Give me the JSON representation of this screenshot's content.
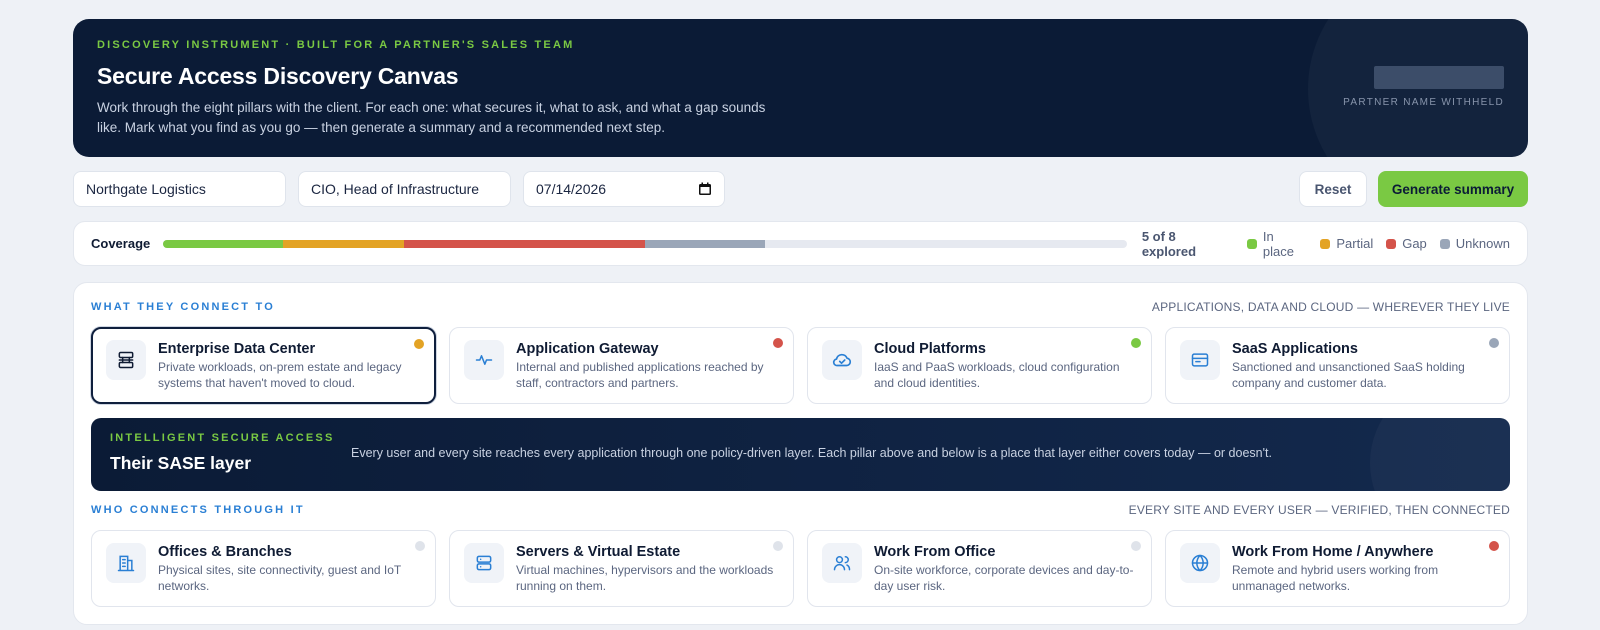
{
  "header": {
    "eyebrow": "DISCOVERY INSTRUMENT · BUILT FOR A PARTNER'S SALES TEAM",
    "title": "Secure Access Discovery Canvas",
    "description": "Work through the eight pillars with the client. For each one: what secures it, what to ask, and what a gap sounds like. Mark what you find as you go — then generate a summary and a recommended next step.",
    "partner_label": "PARTNER NAME WITHHELD"
  },
  "controls": {
    "client_name": "Northgate Logistics",
    "contact_role": "CIO, Head of Infrastructure",
    "date": "07/14/2026",
    "reset_label": "Reset",
    "generate_label": "Generate summary"
  },
  "coverage": {
    "label": "Coverage",
    "explored_text": "5 of 8 explored",
    "segments": [
      {
        "status": "in_place",
        "fraction": 0.125,
        "color": "#7ac943"
      },
      {
        "status": "partial",
        "fraction": 0.125,
        "color": "#e3a325"
      },
      {
        "status": "gap",
        "fraction": 0.25,
        "color": "#d4534a"
      },
      {
        "status": "unknown",
        "fraction": 0.125,
        "color": "#9aa6b8"
      }
    ],
    "legend": [
      {
        "label": "In place",
        "color": "#7ac943"
      },
      {
        "label": "Partial",
        "color": "#e3a325"
      },
      {
        "label": "Gap",
        "color": "#d4534a"
      },
      {
        "label": "Unknown",
        "color": "#9aa6b8"
      }
    ]
  },
  "connect_to": {
    "title": "WHAT THEY CONNECT TO",
    "subtitle": "APPLICATIONS, DATA AND CLOUD — WHEREVER THEY LIVE",
    "cards": [
      {
        "title": "Enterprise Data Center",
        "desc": "Private workloads, on-prem estate and legacy systems that haven't moved to cloud.",
        "icon": "server-rack-icon",
        "status_color": "#e3a325"
      },
      {
        "title": "Application Gateway",
        "desc": "Internal and published applications reached by staff, contractors and partners.",
        "icon": "activity-icon",
        "status_color": "#d4534a"
      },
      {
        "title": "Cloud Platforms",
        "desc": "IaaS and PaaS workloads, cloud configuration and cloud identities.",
        "icon": "cloud-check-icon",
        "status_color": "#7ac943"
      },
      {
        "title": "SaaS Applications",
        "desc": "Sanctioned and unsanctioned SaaS holding company and customer data.",
        "icon": "browser-window-icon",
        "status_color": "#9aa6b8"
      }
    ]
  },
  "sase": {
    "eyebrow": "INTELLIGENT SECURE ACCESS",
    "title": "Their SASE layer",
    "text": "Every user and every site reaches every application through one policy-driven layer. Each pillar above and below is a place that layer either covers today — or doesn't."
  },
  "connect_through": {
    "title": "WHO CONNECTS THROUGH IT",
    "subtitle": "EVERY SITE AND EVERY USER — VERIFIED, THEN CONNECTED",
    "cards": [
      {
        "title": "Offices & Branches",
        "desc": "Physical sites, site connectivity, guest and IoT networks.",
        "icon": "building-icon",
        "status_color": "#dfe3ea"
      },
      {
        "title": "Servers & Virtual Estate",
        "desc": "Virtual machines, hypervisors and the workloads running on them.",
        "icon": "server-icon",
        "status_color": "#dfe3ea"
      },
      {
        "title": "Work From Office",
        "desc": "On-site workforce, corporate devices and day-to-day user risk.",
        "icon": "users-icon",
        "status_color": "#dfe3ea"
      },
      {
        "title": "Work From Home / Anywhere",
        "desc": "Remote and hybrid users working from unmanaged networks.",
        "icon": "globe-icon",
        "status_color": "#d4534a"
      }
    ]
  }
}
